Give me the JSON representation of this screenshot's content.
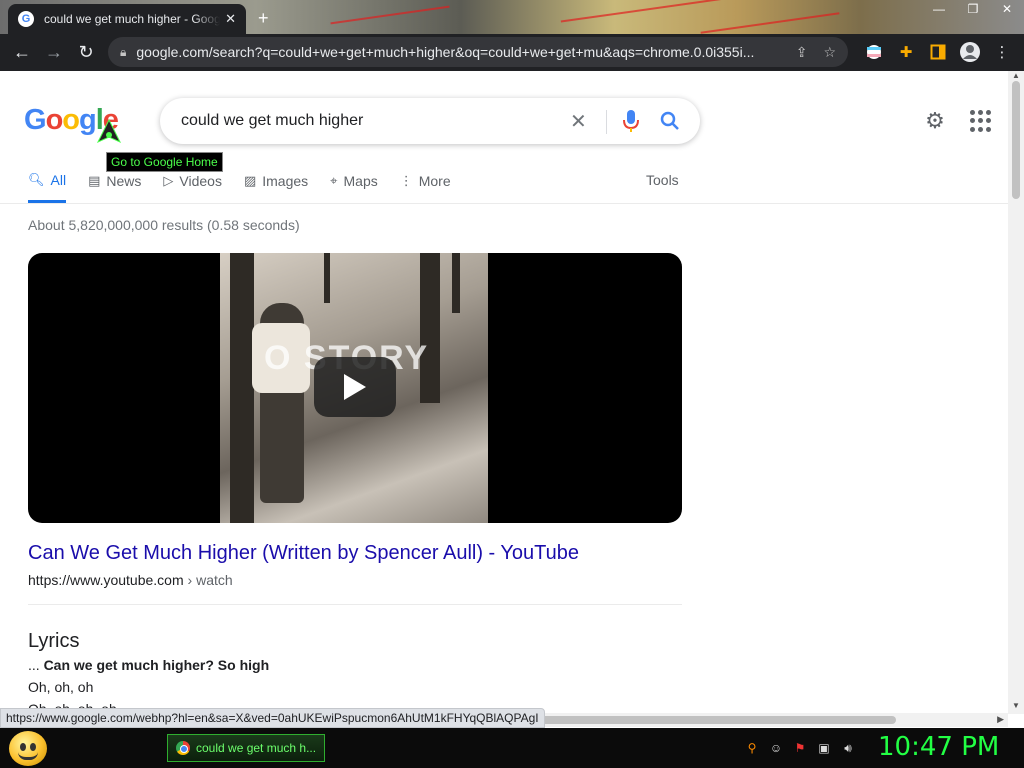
{
  "browser": {
    "tab_title": "could we get much higher - Google Search",
    "tab_close": "✕",
    "new_tab": "+",
    "url": "google.com/search?q=could+we+get+much+higher&oq=could+we+get+mu&aqs=chrome.0.0i355i..."
  },
  "google": {
    "logo_letters": [
      "G",
      "o",
      "o",
      "g",
      "l",
      "e"
    ],
    "logo_tooltip": "Go to Google Home",
    "search_query": "could we get much higher",
    "tabs": [
      {
        "label": "All",
        "icon": "search-icon"
      },
      {
        "label": "News",
        "icon": "news-icon"
      },
      {
        "label": "Videos",
        "icon": "video-icon"
      },
      {
        "label": "Images",
        "icon": "image-icon"
      },
      {
        "label": "Maps",
        "icon": "map-pin-icon"
      },
      {
        "label": "More",
        "icon": "more-vert-icon"
      }
    ],
    "tools_label": "Tools",
    "result_stats": "About 5,820,000,000 results (0.58 seconds)"
  },
  "video": {
    "overlay_text": "O  STORY"
  },
  "result": {
    "title": "Can We Get Much Higher (Written by Spencer Aull) - YouTube",
    "url": "https://www.youtube.com",
    "breadcrumb": " › watch"
  },
  "lyrics": {
    "heading": "Lyrics",
    "line1_prefix": "... ",
    "line1_bold": "Can we get much higher? So high",
    "line2": "Oh, oh, oh",
    "line3": "Oh, oh, oh, oh"
  },
  "status_url": "https://www.google.com/webhp?hl=en&sa=X&ved=0ahUKEwiPspucmon6AhUtM1kFHYqQBlAQPAgI",
  "taskbar": {
    "window_label": "could we get much h...",
    "clock": "10:47 PM"
  },
  "colors": {
    "link": "#1a0dab",
    "accent": "#1a73e8",
    "clock": "#22ff44"
  }
}
